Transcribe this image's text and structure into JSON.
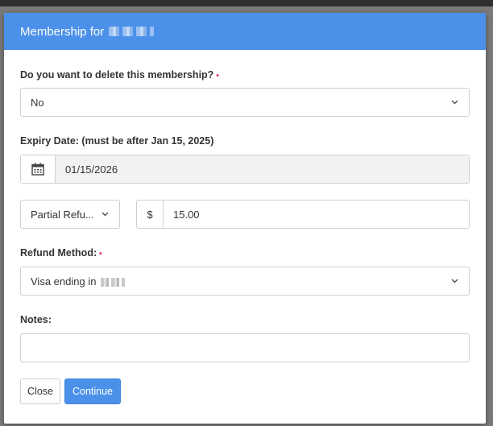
{
  "modal": {
    "title": "Membership for"
  },
  "delete_question": {
    "label": "Do you want to delete this membership?",
    "required_mark": "•",
    "value": "No"
  },
  "expiry": {
    "label": "Expiry Date: (must be after Jan 15, 2025)",
    "value": "01/15/2026"
  },
  "refund": {
    "type_value": "Partial Refu...",
    "currency_symbol": "$",
    "amount": "15.00"
  },
  "refund_method": {
    "label": "Refund Method:",
    "required_mark": "•",
    "value": "Visa ending in"
  },
  "notes": {
    "label": "Notes:",
    "value": ""
  },
  "buttons": {
    "close_label": "Close",
    "continue_label": "Continue"
  },
  "colors": {
    "header_bg": "#4b91ea",
    "primary_button": "#4b91ea",
    "required_marker": "#e0245e"
  },
  "icons": {
    "date": "calendar-icon",
    "dropdown": "chevron-down-icon"
  }
}
